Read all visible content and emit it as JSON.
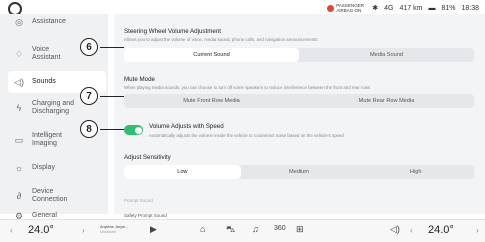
{
  "status": {
    "airbag_label": "PASSENGER AIRBAG ON",
    "bluetooth_icon": "bluetooth-icon",
    "signal": "4G",
    "range": "417 km",
    "battery": "81%",
    "time": "18:38"
  },
  "sidebar": {
    "items": [
      {
        "label": "Assistance",
        "icon": "steering-icon"
      },
      {
        "label": "Voice Assistant",
        "icon": "mic-icon"
      },
      {
        "label": "Sounds",
        "icon": "speaker-icon"
      },
      {
        "label": "Charging and Discharging",
        "icon": "plug-icon"
      },
      {
        "label": "Intelligent Imaging",
        "icon": "camera-icon"
      },
      {
        "label": "Display",
        "icon": "sun-icon"
      },
      {
        "label": "Device Connection",
        "icon": "link-icon"
      },
      {
        "label": "General",
        "icon": "gear-icon"
      }
    ]
  },
  "main": {
    "steering": {
      "title": "Steering Wheel Volume Adjustment",
      "desc": "Allows you to adjust the volume of voice, media sound, phone calls, and navigation announcements",
      "options": [
        "Current Sound",
        "Media Sound"
      ],
      "selected": "Current Sound"
    },
    "mute": {
      "title": "Mute Mode",
      "desc": "When playing media sounds, you can choose to turn off some speakers to reduce interference between the front and rear rows",
      "options": [
        "Mute Front Row Media",
        "Mute Rear Row Media"
      ]
    },
    "speed": {
      "title": "Volume Adjusts with Speed",
      "desc": "Automatically adjusts the volume inside the vehicle to counteract noise based on the vehicle's speed",
      "enabled": true
    },
    "sensitivity": {
      "title": "Adjust Sensitivity",
      "options": [
        "Low",
        "Medium",
        "High"
      ],
      "selected": "Low"
    },
    "prompt_sound": "Prompt Sound",
    "safety_prompt": "Safety Prompt Sound"
  },
  "callouts": [
    "6",
    "7",
    "8"
  ],
  "dock": {
    "left_temp": "24.0°",
    "right_temp": "24.0°",
    "media_title": "Anytime, Anyw...",
    "media_sub": "Unknown",
    "icons": [
      "home-icon",
      "car-icon",
      "music-icon",
      "360-icon",
      "apps-icon",
      "volume-icon"
    ]
  },
  "colors": {
    "accent": "#2fbf71",
    "airbag": "#e0453a"
  }
}
